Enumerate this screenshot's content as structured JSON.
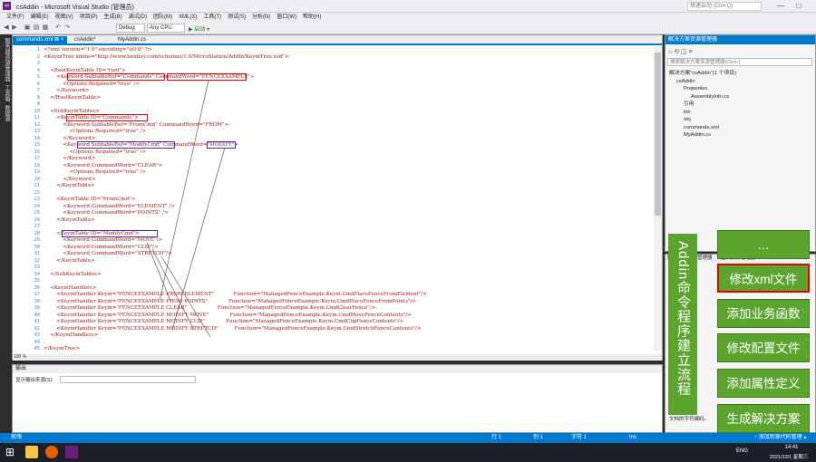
{
  "window": {
    "title": "csAddin - Microsoft Visual Studio (管理员)",
    "quick_launch": "快速启动 (Ctrl+Q)",
    "minimize": "—",
    "maximize": "□"
  },
  "menu": [
    "文件(F)",
    "编辑(E)",
    "视图(V)",
    "项目(P)",
    "生成(B)",
    "调试(D)",
    "团队(M)",
    "XML(X)",
    "工具(T)",
    "测试(S)",
    "分析(N)",
    "窗口(W)",
    "帮助(H)"
  ],
  "toolbar": {
    "config": "Debug",
    "platform": "Any CPU",
    "start": "▶ 启动 ▾"
  },
  "left_strip": [
    "服务器资源管理器",
    "工具箱",
    "数据源"
  ],
  "tabs": [
    {
      "label": "commands.xml ⊠ ×",
      "active": true
    },
    {
      "label": "csAddin*"
    },
    {
      "label": "MyAddin.cs"
    }
  ],
  "code_lines": [
    "<?xml version=\"1.0\" encoding=\"utf-8\" ?>",
    "<KeyinTree xmlns=\"http://www.bentley.com/schemas/1.0/MicroStation/AddIn/KeyinTree.xsd\">",
    "",
    "    <RootKeyinTable ID=\"root\">",
    "        <Keyword SubtableRef=\"Commands\" CommandWord=\"FENCEEXAMPLE\">",
    "            <Options Required=\"true\" />",
    "        </Keyword>",
    "    </RootKeyinTable>",
    "",
    "    <SubKeyinTables>",
    "        <KeyinTable ID=\"Commands\">",
    "            <Keyword SubtableRef=\"FromCmd\" CommandWord=\"FROM\">",
    "                <Options Required=\"true\" />",
    "            </Keyword>",
    "            <Keyword SubtableRef=\"ModifyCmd\" CommandWord=\"MODIFY\">",
    "                <Options Required=\"true\" />",
    "            </Keyword>",
    "            <Keyword CommandWord=\"CLEAR\">",
    "                <Options Required=\"true\" />",
    "            </Keyword>",
    "        </KeyinTable>",
    "",
    "        <KeyinTable ID=\"FromCmd\">",
    "            <Keyword CommandWord=\"ELEMENT\" />",
    "            <Keyword CommandWord=\"POINTS\" />",
    "        </KeyinTable>",
    "",
    "        <KeyinTable ID=\"ModifyCmd\">",
    "            <Keyword CommandWord=\"MOVE\"/>",
    "            <Keyword CommandWord=\"CLIP\"/>",
    "            <Keyword CommandWord=\"STRETCH\"/>",
    "        </KeyinTable>",
    "",
    "    </SubKeyinTables>",
    "",
    "    <KeyinHandlers>",
    "        <KeyinHandler Keyin=\"FENCEEXAMPLE FROM ELEMENT\"            Function=\"ManagedFenceExample.Keyin.CmdPlaceFenceFromElement\"/>",
    "        <KeyinHandler Keyin=\"FENCEEXAMPLE FROM POINTS\"             Function=\"ManagedFenceExample.Keyin.CmdPlaceFenceFromPoints\"/>",
    "        <KeyinHandler Keyin=\"FENCEEXAMPLE CLEAR\"                   Function=\"ManagedFenceExample.Keyin.CmdClearFence\"/>",
    "        <KeyinHandler Keyin=\"FENCEEXAMPLE MODIFY MOVE\"             Function=\"ManagedFenceExample.Keyin.CmdMoveFenceContents\"/>",
    "        <KeyinHandler Keyin=\"FENCEEXAMPLE MODIFY CLIP\"             Function=\"ManagedFenceExample.Keyin.CmdClipFenceContents\"/>",
    "        <KeyinHandler Keyin=\"FENCEEXAMPLE MODIFY STRETCH\"          Function=\"ManagedFenceExample.Keyin.CmdStretchFenceContents\"/>",
    "    </KeyinHandlers>",
    "",
    "</KeyinTree>"
  ],
  "zoom": "100 %",
  "output": {
    "title": "输出",
    "source_label": "显示输出来源(S):"
  },
  "solution": {
    "title": "解决方案资源管理器",
    "search": "搜索解决方案资源管理器(Ctrl+;)",
    "items": [
      {
        "label": "解决方案\"csAddin\"(1 个项目)",
        "indent": 0
      },
      {
        "label": "csAddin",
        "indent": 1
      },
      {
        "label": "Properties",
        "indent": 2
      },
      {
        "label": "AssemblyInfo.cs",
        "indent": 3
      },
      {
        "label": "引用",
        "indent": 2
      },
      {
        "label": "bin",
        "indent": 2
      },
      {
        "label": "obj",
        "indent": 2
      },
      {
        "label": "commands.xml",
        "indent": 2
      },
      {
        "label": "MyAddin.cs",
        "indent": 2
      }
    ]
  },
  "properties": {
    "tabs": [
      "解决方案资源管理器",
      "团队资源管理器"
    ],
    "label": "编码",
    "desc": "文档的字符编码。"
  },
  "overlay": {
    "vertical": "Addin命令程序建立流程",
    "buttons": [
      "…",
      "修改xml文件",
      "添加业务函数",
      "修改配置文件",
      "添加属性定义",
      "生成解决方案"
    ]
  },
  "status": {
    "ready": "就绪",
    "line": "行 1",
    "col": "列 1",
    "char": "字符 1",
    "ins": "Ins",
    "publish": "↑ 添加到源代码管理 ▴"
  },
  "clock": {
    "time": "14:41",
    "date": "2021/12/1 星期三",
    "lang": "ENG"
  }
}
